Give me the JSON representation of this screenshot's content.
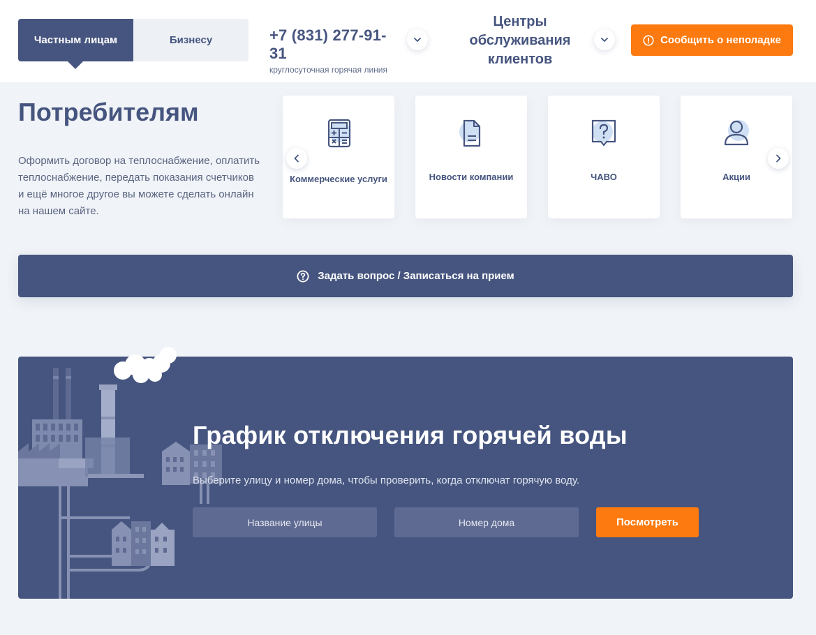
{
  "header": {
    "tabs": [
      {
        "label": "Частным лицам",
        "active": true
      },
      {
        "label": "Бизнесу",
        "active": false
      }
    ],
    "phone": {
      "number": "+7 (831) 277-91-31",
      "caption": "круглосуточная горячая линия"
    },
    "centers_label": "Центры обслуживания клиентов",
    "report_label": "Сообщить о неполадке"
  },
  "consumers": {
    "title": "Потребителям",
    "description": "Оформить договор на теплоснабжение, оплатить теплоснабжение, передать показания счетчиков и ещё многое другое вы можете сделать онлайн на нашем сайте.",
    "cards": [
      {
        "label": "Коммерческие услуги",
        "icon": "calculator-icon"
      },
      {
        "label": "Новости компании",
        "icon": "document-icon"
      },
      {
        "label": "ЧАВО",
        "icon": "question-icon"
      },
      {
        "label": "Акции",
        "icon": "user-icon"
      }
    ],
    "ask_label": "Задать вопрос / Записаться на прием"
  },
  "schedule": {
    "title": "График отключения горячей воды",
    "subtitle": "Выберите улицу и номер дома, чтобы проверить, когда отключат горячую воду.",
    "street_placeholder": "Название улицы",
    "house_placeholder": "Номер дома",
    "submit_label": "Посмотреть"
  },
  "colors": {
    "primary": "#46557f",
    "accent": "#fc7a0f",
    "background": "#f0f3f7"
  }
}
